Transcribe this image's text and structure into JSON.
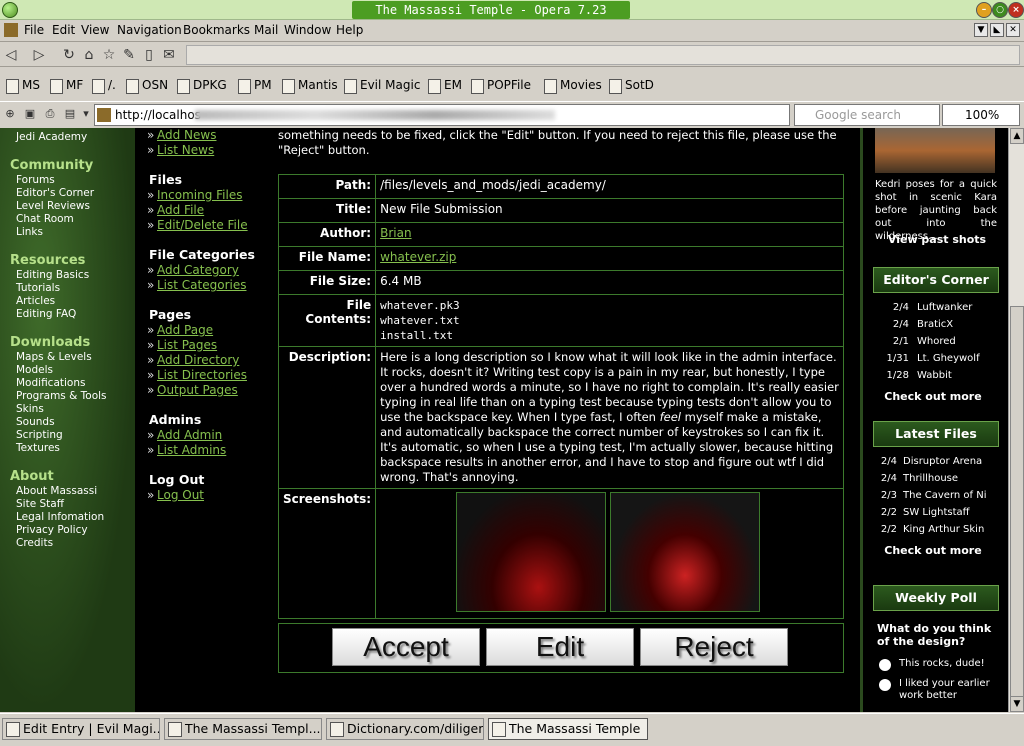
{
  "window": {
    "title": "The Massassi Temple - Opera 7.23"
  },
  "menu": [
    "File",
    "Edit",
    "View",
    "Navigation",
    "Bookmarks",
    "Mail",
    "Window",
    "Help"
  ],
  "bookmarks": [
    "MS",
    "MF",
    "/.",
    "OSN",
    "DPKG",
    "PM",
    "Mantis",
    "Evil Magic",
    "EM",
    "POPFile",
    "Movies",
    "SotD"
  ],
  "address": {
    "url": "http://localhos",
    "search_placeholder": "Google search",
    "zoom": "100%"
  },
  "leftnav": {
    "top_link": "Jedi Academy",
    "sections": [
      {
        "title": "Community",
        "links": [
          "Forums",
          "Editor's Corner",
          "Level Reviews",
          "Chat Room",
          "Links"
        ]
      },
      {
        "title": "Resources",
        "links": [
          "Editing Basics",
          "Tutorials",
          "Articles",
          "Editing FAQ"
        ]
      },
      {
        "title": "Downloads",
        "links": [
          "Maps & Levels",
          "Models",
          "Modifications",
          "Programs & Tools",
          "Skins",
          "Sounds",
          "Scripting",
          "Textures"
        ]
      },
      {
        "title": "About",
        "links": [
          "About Massassi",
          "Site Staff",
          "Legal Infomation",
          "Privacy Policy",
          "Credits"
        ]
      }
    ]
  },
  "adminnav": {
    "top_links": [
      "Add News",
      "List News"
    ],
    "sections": [
      {
        "title": "Files",
        "links": [
          "Incoming Files",
          "Add File",
          "Edit/Delete File"
        ]
      },
      {
        "title": "File Categories",
        "links": [
          "Add Category",
          "List Categories"
        ]
      },
      {
        "title": "Pages",
        "links": [
          "Add Page",
          "List Pages",
          "Add Directory",
          "List Directories",
          "Output Pages"
        ]
      },
      {
        "title": "Admins",
        "links": [
          "Add Admin",
          "List Admins"
        ]
      },
      {
        "title": "Log Out",
        "links": [
          "Log Out"
        ]
      }
    ]
  },
  "main": {
    "intro": "something needs to be fixed, click the \"Edit\" button. If you need to reject this file, please use the \"Reject\" button.",
    "fields": {
      "path_label": "Path:",
      "path": "/files/levels_and_mods/jedi_academy/",
      "title_label": "Title:",
      "title": "New File Submission",
      "author_label": "Author:",
      "author": "Brian",
      "filename_label": "File Name:",
      "filename": "whatever.zip",
      "filesize_label": "File Size:",
      "filesize": "6.4 MB",
      "contents_label": "File Contents:",
      "contents": [
        "whatever.pk3",
        "whatever.txt",
        "install.txt"
      ],
      "description_label": "Description:",
      "description_before": "Here is a long description so I know what it will look like in the admin interface. It rocks, doesn't it? Writing test copy is a pain in my rear, but honestly, I type over a hundred words a minute, so I have no right to complain. It's really easier typing in real life than on a typing test because typing tests don't allow you to use the backspace key. When I type fast, I often ",
      "description_em": "feel",
      "description_after": " myself make a mistake, and automatically backspace the correct number of keystrokes so I can fix it. It's automatic, so when I use a typing test, I'm actually slower, because hitting backspace results in another error, and I have to stop and figure out wtf I did wrong. That's annoying.",
      "screenshots_label": "Screenshots:"
    },
    "buttons": {
      "accept": "Accept",
      "edit": "Edit",
      "reject": "Reject"
    }
  },
  "rightcol": {
    "caption": "Kedri poses for a quick shot in scenic Kara before jaunting back out into the wilderness...",
    "past_shots": "View past shots",
    "editors_corner": {
      "title": "Editor's Corner",
      "items": [
        [
          "2/4",
          "Luftwanker"
        ],
        [
          "2/4",
          "BraticX"
        ],
        [
          "2/1",
          "Whored"
        ],
        [
          "1/31",
          "Lt. Gheywolf"
        ],
        [
          "1/28",
          "Wabbit"
        ]
      ],
      "more": "Check out more"
    },
    "latest_files": {
      "title": "Latest Files",
      "items": [
        [
          "2/4",
          "Disruptor Arena"
        ],
        [
          "2/4",
          "Thrillhouse"
        ],
        [
          "2/3",
          "The Cavern of Ni"
        ],
        [
          "2/2",
          "SW Lightstaff"
        ],
        [
          "2/2",
          "King Arthur Skin"
        ]
      ],
      "more": "Check out more"
    },
    "poll": {
      "title": "Weekly Poll",
      "question": "What do you think of the design?",
      "options": [
        "This rocks, dude!",
        "I liked your earlier work better"
      ]
    }
  },
  "taskbar": [
    "Edit Entry | Evil Magi...",
    "The Massassi Templ...",
    "Dictionary.com/diligent",
    "The Massassi Temple"
  ]
}
